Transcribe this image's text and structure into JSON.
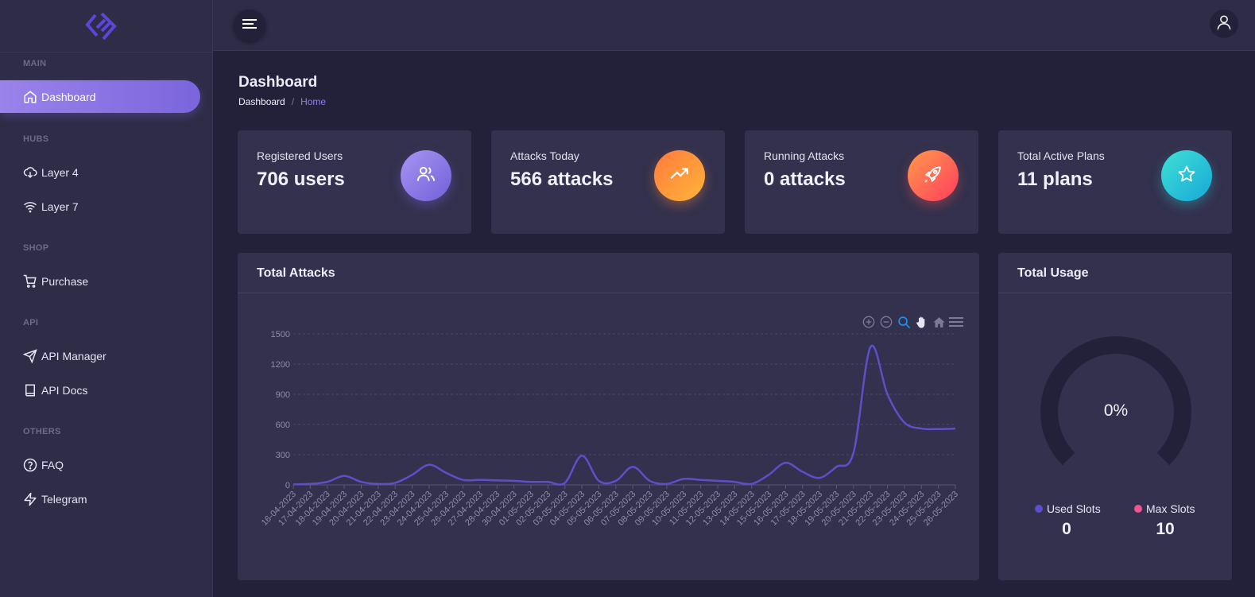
{
  "sidebar": {
    "sections": [
      {
        "label": "MAIN"
      },
      {
        "label": "HUBS"
      },
      {
        "label": "SHOP"
      },
      {
        "label": "API"
      },
      {
        "label": "OTHERS"
      }
    ],
    "items": [
      {
        "label": "Dashboard",
        "icon": "home-icon",
        "active": true
      },
      {
        "label": "Layer 4",
        "icon": "cloud-download-icon"
      },
      {
        "label": "Layer 7",
        "icon": "wifi-icon"
      },
      {
        "label": "Purchase",
        "icon": "shopping-cart-icon"
      },
      {
        "label": "API Manager",
        "icon": "send-icon"
      },
      {
        "label": "API Docs",
        "icon": "book-icon"
      },
      {
        "label": "FAQ",
        "icon": "help-circle-icon"
      },
      {
        "label": "Telegram",
        "icon": "zap-icon"
      }
    ]
  },
  "header": {
    "title": "Dashboard",
    "breadcrumb": [
      "Dashboard",
      "Home"
    ]
  },
  "stats": [
    {
      "label": "Registered Users",
      "value": "706 users",
      "icon": "users-icon",
      "color": "#7f6ae0"
    },
    {
      "label": "Attacks Today",
      "value": "566 attacks",
      "icon": "trending-up-icon",
      "color": "#ff9a3c"
    },
    {
      "label": "Running Attacks",
      "value": "0 attacks",
      "icon": "rocket-icon",
      "color": "#ff5a55"
    },
    {
      "label": "Total Active Plans",
      "value": "11 plans",
      "icon": "star-icon",
      "color": "#27c3d6"
    }
  ],
  "attacks_panel": {
    "title": "Total Attacks",
    "tools": [
      "zoom-in-icon",
      "zoom-out-icon",
      "zoom-select-icon",
      "pan-hand-icon",
      "reset-home-icon",
      "menu-icon"
    ]
  },
  "usage_panel": {
    "title": "Total Usage",
    "gauge_value": 0,
    "gauge_label": "0%",
    "legend": [
      {
        "label": "Used Slots",
        "value": "0",
        "color": "#5b4fd0"
      },
      {
        "label": "Max Slots",
        "value": "10",
        "color": "#f0558f"
      }
    ]
  },
  "colors": {
    "accent": "#7b65dc",
    "line": "#5d4fc8",
    "background": "#23213a",
    "card": "#33314d"
  },
  "chart_data": {
    "type": "line",
    "title": "",
    "xlabel": "",
    "ylabel": "",
    "ylim": [
      0,
      1500
    ],
    "yticks": [
      0,
      300,
      600,
      900,
      1200,
      1500
    ],
    "grid": true,
    "categories": [
      "16-04-2023",
      "17-04-2023",
      "18-04-2023",
      "19-04-2023",
      "20-04-2023",
      "21-04-2023",
      "22-04-2023",
      "23-04-2023",
      "24-04-2023",
      "25-04-2023",
      "26-04-2023",
      "27-04-2023",
      "28-04-2023",
      "30-04-2023",
      "01-05-2023",
      "02-05-2023",
      "03-05-2023",
      "04-05-2023",
      "05-05-2023",
      "06-05-2023",
      "07-05-2023",
      "08-05-2023",
      "09-05-2023",
      "10-05-2023",
      "11-05-2023",
      "12-05-2023",
      "13-05-2023",
      "14-05-2023",
      "15-05-2023",
      "16-05-2023",
      "17-05-2023",
      "18-05-2023",
      "19-05-2023",
      "20-05-2023",
      "21-05-2023",
      "22-05-2023",
      "23-05-2023",
      "24-05-2023",
      "25-05-2023",
      "26-05-2023"
    ],
    "series": [
      {
        "values": [
          5,
          10,
          30,
          90,
          30,
          10,
          20,
          100,
          200,
          120,
          50,
          50,
          45,
          40,
          30,
          30,
          20,
          290,
          40,
          40,
          180,
          40,
          10,
          60,
          50,
          40,
          30,
          10,
          100,
          220,
          130,
          70,
          180,
          320,
          1370,
          900,
          620,
          560,
          555,
          560
        ]
      }
    ]
  }
}
